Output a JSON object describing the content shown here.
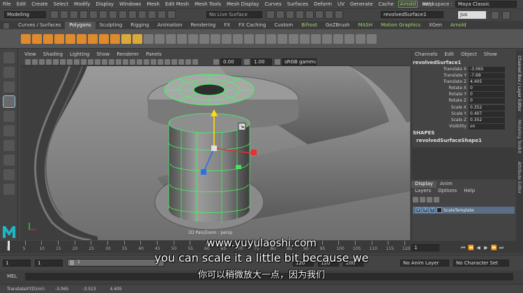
{
  "menubar": {
    "items": [
      "File",
      "Edit",
      "Create",
      "Select",
      "Modify",
      "Display",
      "Windows",
      "Mesh",
      "Edit Mesh",
      "Mesh Tools",
      "Mesh Display",
      "Curves",
      "Surfaces",
      "Deform",
      "UV",
      "Generate",
      "Cache",
      "Arnold",
      "Help"
    ],
    "workspace_label": "Workspace :",
    "workspace_value": "Maya Classic"
  },
  "statusline": {
    "mode": "Modeling",
    "live_surface": "No Live Surface",
    "object_field": "revolvedSurface1",
    "user": "Jus"
  },
  "shelf_tabs": [
    "Curves / Surfaces",
    "Polygons",
    "Sculpting",
    "Rigging",
    "Animation",
    "Rendering",
    "FX",
    "FX Caching",
    "Custom",
    "Bifrost",
    "GoZBrush",
    "MASH",
    "Motion Graphics",
    "XGen",
    "Arnold"
  ],
  "shelf_active": "Polygons",
  "viewport": {
    "menu": [
      "View",
      "Shading",
      "Lighting",
      "Show",
      "Renderer",
      "Panels"
    ],
    "exposure": "0.00",
    "gamma": "1.00",
    "colorspace": "sRGB gamma",
    "status_label": "2D Pan/Zoom : persp"
  },
  "channel_box": {
    "menu": [
      "Channels",
      "Edit",
      "Object",
      "Show"
    ],
    "object_name": "revolvedSurface1",
    "attributes": [
      {
        "label": "Translate X",
        "value": "-3.065"
      },
      {
        "label": "Translate Y",
        "value": "-7.68"
      },
      {
        "label": "Translate Z",
        "value": "4.405"
      },
      {
        "label": "Rotate X",
        "value": "0"
      },
      {
        "label": "Rotate Y",
        "value": "0"
      },
      {
        "label": "Rotate Z",
        "value": "0"
      },
      {
        "label": "Scale X",
        "value": "0.352"
      },
      {
        "label": "Scale Y",
        "value": "0.407"
      },
      {
        "label": "Scale Z",
        "value": "0.352"
      },
      {
        "label": "Visibility",
        "value": "on"
      }
    ],
    "shapes_header": "SHAPES",
    "shape_name": "revolvedSurfaceShape1"
  },
  "layer_editor": {
    "tabs": [
      "Display",
      "Anim"
    ],
    "menu": [
      "Layers",
      "Options",
      "Help"
    ],
    "layer": {
      "v": "V",
      "p": "P",
      "t": "T",
      "name": "ScaleTemplate"
    }
  },
  "side_tabs": [
    "Channel Box / Layer Editor",
    "Modeling Toolkit",
    "Attribute Editor"
  ],
  "timeline": {
    "ticks": [
      "1",
      "5",
      "10",
      "15",
      "20",
      "25",
      "30",
      "35",
      "40",
      "45",
      "50",
      "55",
      "60",
      "65",
      "70",
      "75",
      "80",
      "85",
      "90",
      "95",
      "100",
      "105",
      "110",
      "115",
      "120"
    ],
    "current_frame": "1"
  },
  "range": {
    "start": "1",
    "start2": "1",
    "slider_frame": "1",
    "end_a": "120",
    "end_b": "120",
    "end_c": "200",
    "anim_layer": "No Anim Layer",
    "character_set": "No Character Set"
  },
  "cmdline": {
    "label": "MEL"
  },
  "helpline": {
    "label": "TranslateXYZ(cm):",
    "x": "-3.065",
    "y": "-3.513",
    "z": "4.405"
  },
  "subtitles": {
    "url": "www.yuyulaoshi.com",
    "english": "you can scale it a little bit because we",
    "chinese": "你可以稍微放大一点，因为我们"
  },
  "colors": {
    "accent_green": "#9bd96a",
    "shelf_orange": "#e08a2e",
    "selection_green": "#3dff5a",
    "manip_y": "#ffdd00",
    "manip_x": "#e8302e",
    "manip_z": "#2e6fe8"
  }
}
